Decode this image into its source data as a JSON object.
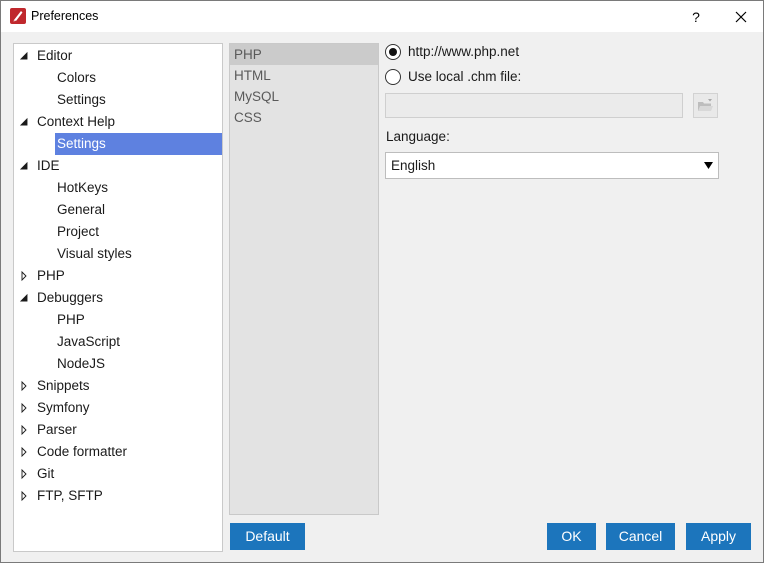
{
  "window": {
    "title": "Preferences",
    "help_label": "?"
  },
  "tree": [
    {
      "label": "Editor",
      "level": 0,
      "state": "expanded"
    },
    {
      "label": "Colors",
      "level": 1,
      "state": "leaf"
    },
    {
      "label": "Settings",
      "level": 1,
      "state": "leaf"
    },
    {
      "label": "Context Help",
      "level": 0,
      "state": "expanded"
    },
    {
      "label": "Settings",
      "level": 1,
      "state": "leaf",
      "selected": true
    },
    {
      "label": "IDE",
      "level": 0,
      "state": "expanded"
    },
    {
      "label": "HotKeys",
      "level": 1,
      "state": "leaf"
    },
    {
      "label": "General",
      "level": 1,
      "state": "leaf"
    },
    {
      "label": "Project",
      "level": 1,
      "state": "leaf"
    },
    {
      "label": "Visual styles",
      "level": 1,
      "state": "leaf"
    },
    {
      "label": "PHP",
      "level": 0,
      "state": "collapsed"
    },
    {
      "label": "Debuggers",
      "level": 0,
      "state": "expanded"
    },
    {
      "label": "PHP",
      "level": 1,
      "state": "leaf"
    },
    {
      "label": "JavaScript",
      "level": 1,
      "state": "leaf"
    },
    {
      "label": "NodeJS",
      "level": 1,
      "state": "leaf"
    },
    {
      "label": "Snippets",
      "level": 0,
      "state": "collapsed"
    },
    {
      "label": "Symfony",
      "level": 0,
      "state": "collapsed"
    },
    {
      "label": "Parser",
      "level": 0,
      "state": "collapsed"
    },
    {
      "label": "Code formatter",
      "level": 0,
      "state": "collapsed"
    },
    {
      "label": "Git",
      "level": 0,
      "state": "collapsed"
    },
    {
      "label": "FTP, SFTP",
      "level": 0,
      "state": "collapsed"
    }
  ],
  "help_languages": [
    {
      "label": "PHP",
      "selected": true
    },
    {
      "label": "HTML"
    },
    {
      "label": "MySQL"
    },
    {
      "label": "CSS"
    }
  ],
  "source": {
    "online_label": "http://www.php.net",
    "local_label": "Use local .chm file:",
    "selected": "online",
    "local_path": ""
  },
  "language": {
    "label": "Language:",
    "value": "English"
  },
  "buttons": {
    "default": "Default",
    "ok": "OK",
    "cancel": "Cancel",
    "apply": "Apply"
  },
  "colors": {
    "accent": "#1c75bc",
    "selection": "#5e81e0",
    "app_icon": "#c0282d"
  }
}
